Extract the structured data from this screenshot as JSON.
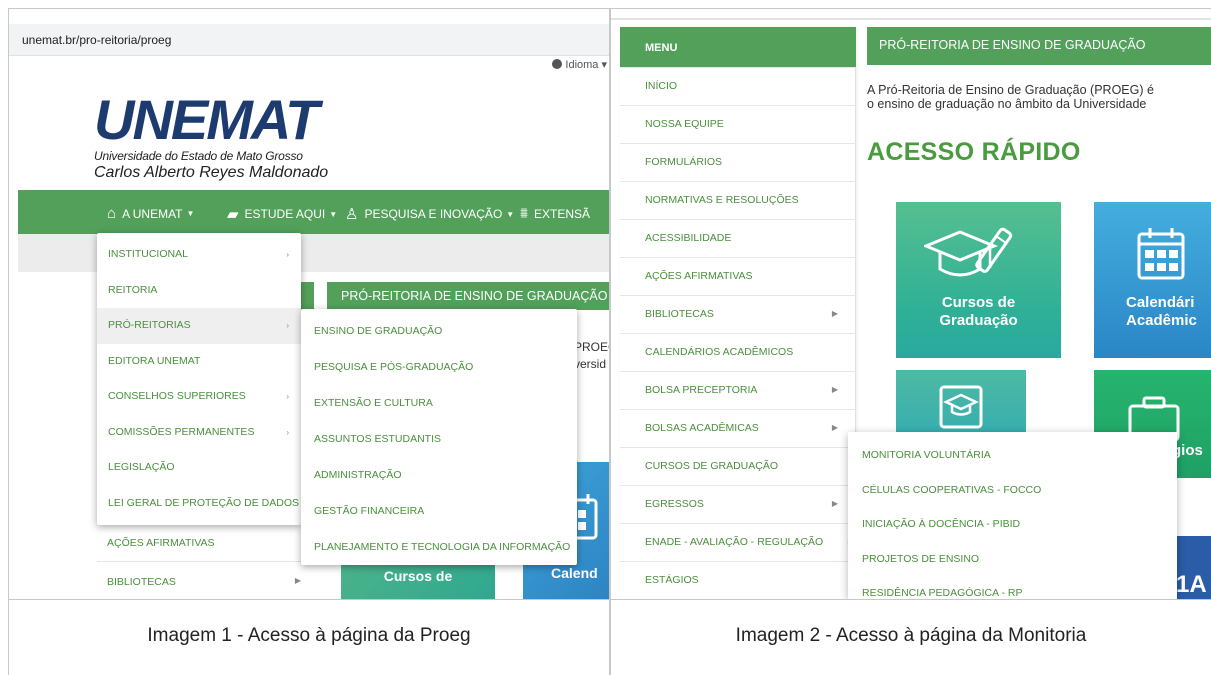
{
  "panel1": {
    "url": "unemat.br/pro-reitoria/proeg",
    "language_label": "Idioma",
    "logo": {
      "main": "UNEMAT",
      "subtitle": "Universidade do Estado de Mato Grosso",
      "name": "Carlos Alberto Reyes Maldonado"
    },
    "nav": [
      {
        "label": "A UNEMAT",
        "icon": "home-icon"
      },
      {
        "label": "ESTUDE AQUI",
        "icon": "book-icon"
      },
      {
        "label": "PESQUISA E INOVAÇÃO",
        "icon": "research-icon"
      },
      {
        "label": "EXTENSÃ",
        "icon": "institution-icon"
      }
    ],
    "dropdown": [
      {
        "label": "INSTITUCIONAL",
        "submenu": true
      },
      {
        "label": "REITORIA",
        "submenu": false
      },
      {
        "label": "PRÓ-REITORIAS",
        "submenu": true,
        "active": true
      },
      {
        "label": "EDITORA UNEMAT",
        "submenu": false
      },
      {
        "label": "CONSELHOS SUPERIORES",
        "submenu": true
      },
      {
        "label": "COMISSÕES PERMANENTES",
        "submenu": true
      },
      {
        "label": "LEGISLAÇÃO",
        "submenu": false
      },
      {
        "label": "LEI GERAL DE PROTEÇÃO DE DADOS",
        "submenu": false
      }
    ],
    "submenu": [
      "ENSINO DE GRADUAÇÃO",
      "PESQUISA E PÓS-GRADUAÇÃO",
      "EXTENSÃO E CULTURA",
      "ASSUNTOS ESTUDANTIS",
      "ADMINISTRAÇÃO",
      "GESTÃO FINANCEIRA",
      "PLANEJAMENTO E TECNOLOGIA DA INFORMAÇÃO"
    ],
    "page_header": "PRÓ-REITORIA DE ENSINO DE GRADUAÇÃO",
    "text_fragment_1": "PROEG",
    "text_fragment_2": "versid",
    "side_items": [
      "AÇÕES AFIRMATIVAS",
      "BIBLIOTECAS"
    ],
    "card_a": "Cursos de",
    "card_b": "Calend"
  },
  "panel2": {
    "menu_title": "MENU",
    "menu_items": [
      {
        "label": "INÍCIO",
        "submenu": false
      },
      {
        "label": "NOSSA EQUIPE",
        "submenu": false
      },
      {
        "label": "FORMULÁRIOS",
        "submenu": false
      },
      {
        "label": "NORMATIVAS E RESOLUÇÕES",
        "submenu": false
      },
      {
        "label": "ACESSIBILIDADE",
        "submenu": false
      },
      {
        "label": "AÇÕES AFIRMATIVAS",
        "submenu": false
      },
      {
        "label": "BIBLIOTECAS",
        "submenu": true
      },
      {
        "label": "CALENDÁRIOS ACADÊMICOS",
        "submenu": false
      },
      {
        "label": "BOLSA PRECEPTORIA",
        "submenu": true
      },
      {
        "label": "BOLSAS ACADÊMICAS",
        "submenu": true
      },
      {
        "label": "CURSOS DE GRADUAÇÃO",
        "submenu": false
      },
      {
        "label": "EGRESSOS",
        "submenu": true
      },
      {
        "label": "ENADE - AVALIAÇÃO - REGULAÇÃO",
        "submenu": true
      },
      {
        "label": "ESTÁGIOS",
        "submenu": false
      }
    ],
    "page_header": "PRÓ-REITORIA DE ENSINO DE GRADUAÇÃO",
    "intro_line1": "A Pró-Reitoria de Ensino de Graduação (PROEG) é",
    "intro_line2": "o ensino de graduação no âmbito da Universidade",
    "quick_access": "ACESSO RÁPIDO",
    "cards": {
      "cursos_line1": "Cursos de",
      "cursos_line2": "Graduação",
      "calendario_line1": "Calendári",
      "calendario_line2": "Acadêmic",
      "estagios": "gios",
      "partial": "1A"
    },
    "submenu": [
      "MONITORIA VOLUNTÁRIA",
      "CÉLULAS COOPERATIVAS - FOCCO",
      "INICIAÇÃO À DOCÊNCIA - PIBID",
      "PROJETOS DE ENSINO",
      "RESIDÊNCIA PEDAGÓGICA - RP"
    ]
  },
  "captions": {
    "image1": "Imagem 1 - Acesso à página da Proeg",
    "image2": "Imagem 2 - Acesso à página da Monitoria"
  },
  "colors": {
    "green": "#53a05b",
    "link_green": "#4a8f3d",
    "navy": "#1d3b6f",
    "teal_card": "#2fb096",
    "blue_card": "#2a86c6"
  }
}
